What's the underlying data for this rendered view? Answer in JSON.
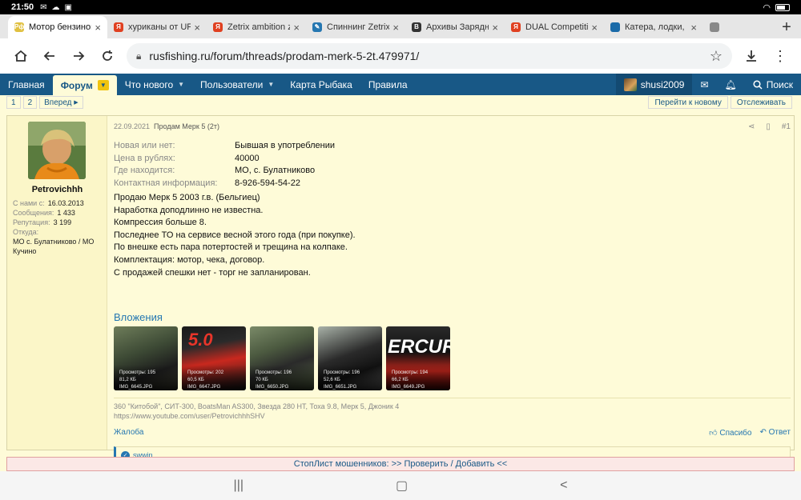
{
  "status": {
    "time": "21:50"
  },
  "tabs": [
    {
      "title": "Мотор бензиново",
      "fav_color": "#e0c040",
      "fav_text": "Рф",
      "active": true
    },
    {
      "title": "хуриканы от UF",
      "fav_color": "#e04020",
      "fav_text": "Я"
    },
    {
      "title": "Zetrix ambition z",
      "fav_color": "#e04020",
      "fav_text": "Я"
    },
    {
      "title": "Спиннинг Zetrix",
      "fav_color": "#2577b1",
      "fav_text": "✎"
    },
    {
      "title": "Архивы Зарядн",
      "fav_color": "#333333",
      "fav_text": "B"
    },
    {
      "title": "DUAL Competitio",
      "fav_color": "#e04020",
      "fav_text": "Я"
    },
    {
      "title": "Катера, лодки,",
      "fav_color": "#1a6aa8",
      "fav_text": ""
    },
    {
      "title": "",
      "fav_color": "#888888",
      "fav_text": ""
    }
  ],
  "address": {
    "url": "rusfishing.ru/forum/threads/prodam-merk-5-2t.479971/"
  },
  "forum_nav": {
    "items": [
      "Главная",
      "Форум",
      "Что нового",
      "Пользователи",
      "Карта Рыбака",
      "Правила"
    ],
    "user": "shusi2009",
    "search": "Поиск"
  },
  "pagination": {
    "pages": [
      "1",
      "2"
    ],
    "next": "Вперед",
    "goto_new": "Перейти к новому",
    "watch": "Отслеживать"
  },
  "post": {
    "author": "Petrovichhh",
    "stats": [
      {
        "label": "С нами с:",
        "value": "16.03.2013"
      },
      {
        "label": "Сообщения:",
        "value": "1 433"
      },
      {
        "label": "Репутация:",
        "value": "3 199"
      }
    ],
    "location_label": "Откуда:",
    "location": "МО с. Булатниково / МО Кучино",
    "date": "22.09.2021",
    "thread": "Продам Мерк 5 (2т)",
    "number": "#1",
    "fields": [
      {
        "label": "Новая или нет:",
        "value": "Бывшая в употреблении"
      },
      {
        "label": "Цена в рублях:",
        "value": "40000"
      },
      {
        "label": "Где находится:",
        "value": "МО, с. Булатниково"
      },
      {
        "label": "Контактная информация:",
        "value": "8-926-594-54-22"
      }
    ],
    "message": [
      "Продаю Мерк 5 2003 г.в. (Бельгиец)",
      "Наработка доподлинно не известна.",
      "Компрессия больше 8.",
      "Последнее ТО на сервисе весной этого года (при покупке).",
      "По внешке есть пара потертостей и трещина на колпаке.",
      "Комплектация: мотор, чека, договор.",
      "С продажей спешки нет - торг не запланирован."
    ],
    "attachments_title": "Вложения",
    "attachments": [
      {
        "views": "Просмотры: 195",
        "size": "81,2 КБ",
        "name": "IMG_6645.JPG"
      },
      {
        "views": "Просмотры: 202",
        "size": "60,5 КБ",
        "name": "IMG_6647.JPG",
        "overlay": "5.0"
      },
      {
        "views": "Просмотры: 196",
        "size": "70 КБ",
        "name": "IMG_6650.JPG"
      },
      {
        "views": "Просмотры: 196",
        "size": "52,6 КБ",
        "name": "IMG_6651.JPG"
      },
      {
        "views": "Просмотры: 194",
        "size": "66,2 КБ",
        "name": "IMG_6649.JPG",
        "overlay": "ERCUR"
      }
    ],
    "signature": [
      "360 \"Китобой\", СИТ-300, BoatsMan AS300, Звезда 280 НТ, Тоха 9.8, Мерк 5, Джоник 4",
      "https://www.youtube.com/user/PetrovichhhSHV"
    ],
    "report": "Жалоба",
    "like": "Спасибо",
    "reply": "Ответ",
    "reaction_user": "swwin"
  },
  "stoplist": "СтопЛист мошенников: >> Проверить / Добавить <<"
}
